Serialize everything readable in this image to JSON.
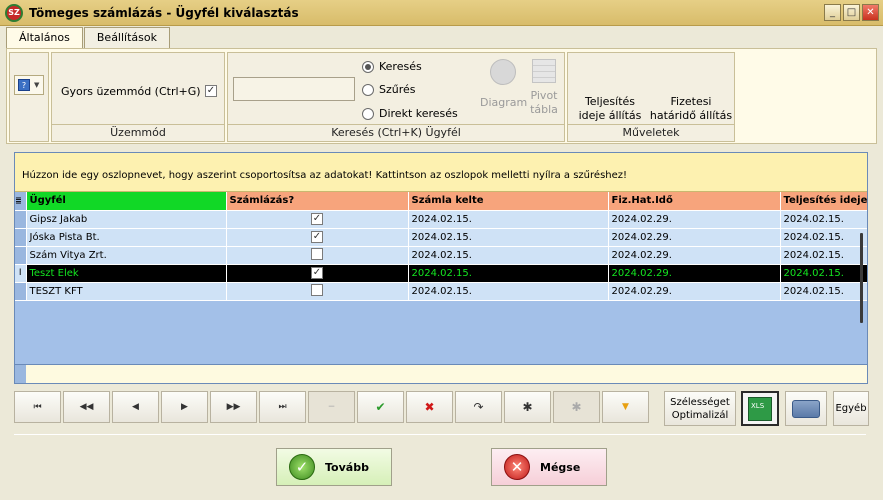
{
  "window": {
    "title": "Tömeges számlázás - Ügyfél kiválasztás",
    "logo_text": "SZ",
    "minimize": "_",
    "maximize": "□",
    "close": "✕"
  },
  "tabs": [
    {
      "label": "Általános",
      "active": true
    },
    {
      "label": "Beállítások",
      "active": false
    }
  ],
  "ribbon": {
    "mode": {
      "quick_label": "Gyors üzemmód (Ctrl+G)",
      "quick_checked": true,
      "group_label": "Üzemmód"
    },
    "search": {
      "input_value": "",
      "options": [
        {
          "label": "Keresés",
          "checked": true
        },
        {
          "label": "Szűrés",
          "checked": false
        },
        {
          "label": "Direkt keresés",
          "checked": false
        }
      ],
      "diagram_label": "Diagram",
      "pivot_line1": "Pivot",
      "pivot_line2": "tábla",
      "group_label": "Keresés (Ctrl+K) Ügyfél"
    },
    "actions": {
      "btn1_line1": "Teljesítés",
      "btn1_line2": "ideje állítás",
      "btn2_line1": "Fizetesi",
      "btn2_line2": "határidő állítás",
      "group_label": "Műveletek"
    }
  },
  "grid": {
    "group_hint": "Húzzon ide egy oszlopnevet, hogy aszerint csoportosítsa az adatokat! Kattintson az oszlopok melletti nyílra a szűréshez!",
    "columns": [
      "Ügyfél",
      "Számlázás?",
      "Számla kelte",
      "Fiz.Hat.Idő",
      "Teljesítés ideje"
    ],
    "rows": [
      {
        "name": "Gipsz Jakab",
        "billing": true,
        "invoice_date": "2024.02.15.",
        "due_date": "2024.02.29.",
        "fulfil_date": "2024.02.15."
      },
      {
        "name": "Jóska Pista Bt.",
        "billing": true,
        "invoice_date": "2024.02.15.",
        "due_date": "2024.02.29.",
        "fulfil_date": "2024.02.15."
      },
      {
        "name": "Szám Vitya Zrt.",
        "billing": false,
        "invoice_date": "2024.02.15.",
        "due_date": "2024.02.29.",
        "fulfil_date": "2024.02.15."
      },
      {
        "name": "Teszt Elek",
        "billing": true,
        "invoice_date": "2024.02.15.",
        "due_date": "2024.02.29.",
        "fulfil_date": "2024.02.15.",
        "selected": true
      },
      {
        "name": "TESZT KFT",
        "billing": false,
        "invoice_date": "2024.02.15.",
        "due_date": "2024.02.29.",
        "fulfil_date": "2024.02.15."
      }
    ]
  },
  "navigator": {
    "first": "⏮",
    "prev_page": "◀◀",
    "prev": "◀",
    "next": "▶",
    "next_page": "▶▶",
    "last": "⏭",
    "delete": "−",
    "post": "✔",
    "cancel": "✖",
    "refresh": "↷",
    "insert": "✱",
    "insert2": "✱",
    "filter": "▼"
  },
  "tools": {
    "optimize_line1": "Szélességet",
    "optimize_line2": "Optimalizál",
    "other": "Egyéb"
  },
  "footer": {
    "ok_label": "Tovább",
    "cancel_label": "Mégse"
  },
  "colors": {
    "header_first": "#11d826",
    "header": "#f7a47c",
    "selected_text": "#13e620",
    "grid_bg": "#a3c0e8"
  }
}
